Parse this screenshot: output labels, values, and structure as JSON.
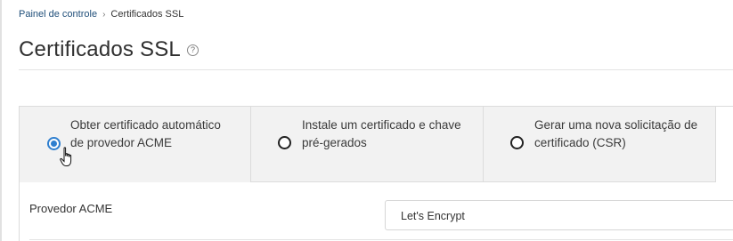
{
  "breadcrumb": {
    "home": "Painel de controle",
    "separator": "›",
    "current": "Certificados SSL"
  },
  "page": {
    "title": "Certificados SSL",
    "help_icon": "?"
  },
  "tabs": [
    {
      "label": "Obter certificado automático de provedor ACME",
      "selected": true
    },
    {
      "label": "Instale um certificado e chave pré-gerados",
      "selected": false
    },
    {
      "label": "Gerar uma nova solicitação de certificado (CSR)",
      "selected": false
    }
  ],
  "form": {
    "provider_label": "Provedor ACME",
    "provider_value": "Let's Encrypt"
  },
  "colors": {
    "accent": "#2f7fcf",
    "link": "#1f4e79"
  }
}
